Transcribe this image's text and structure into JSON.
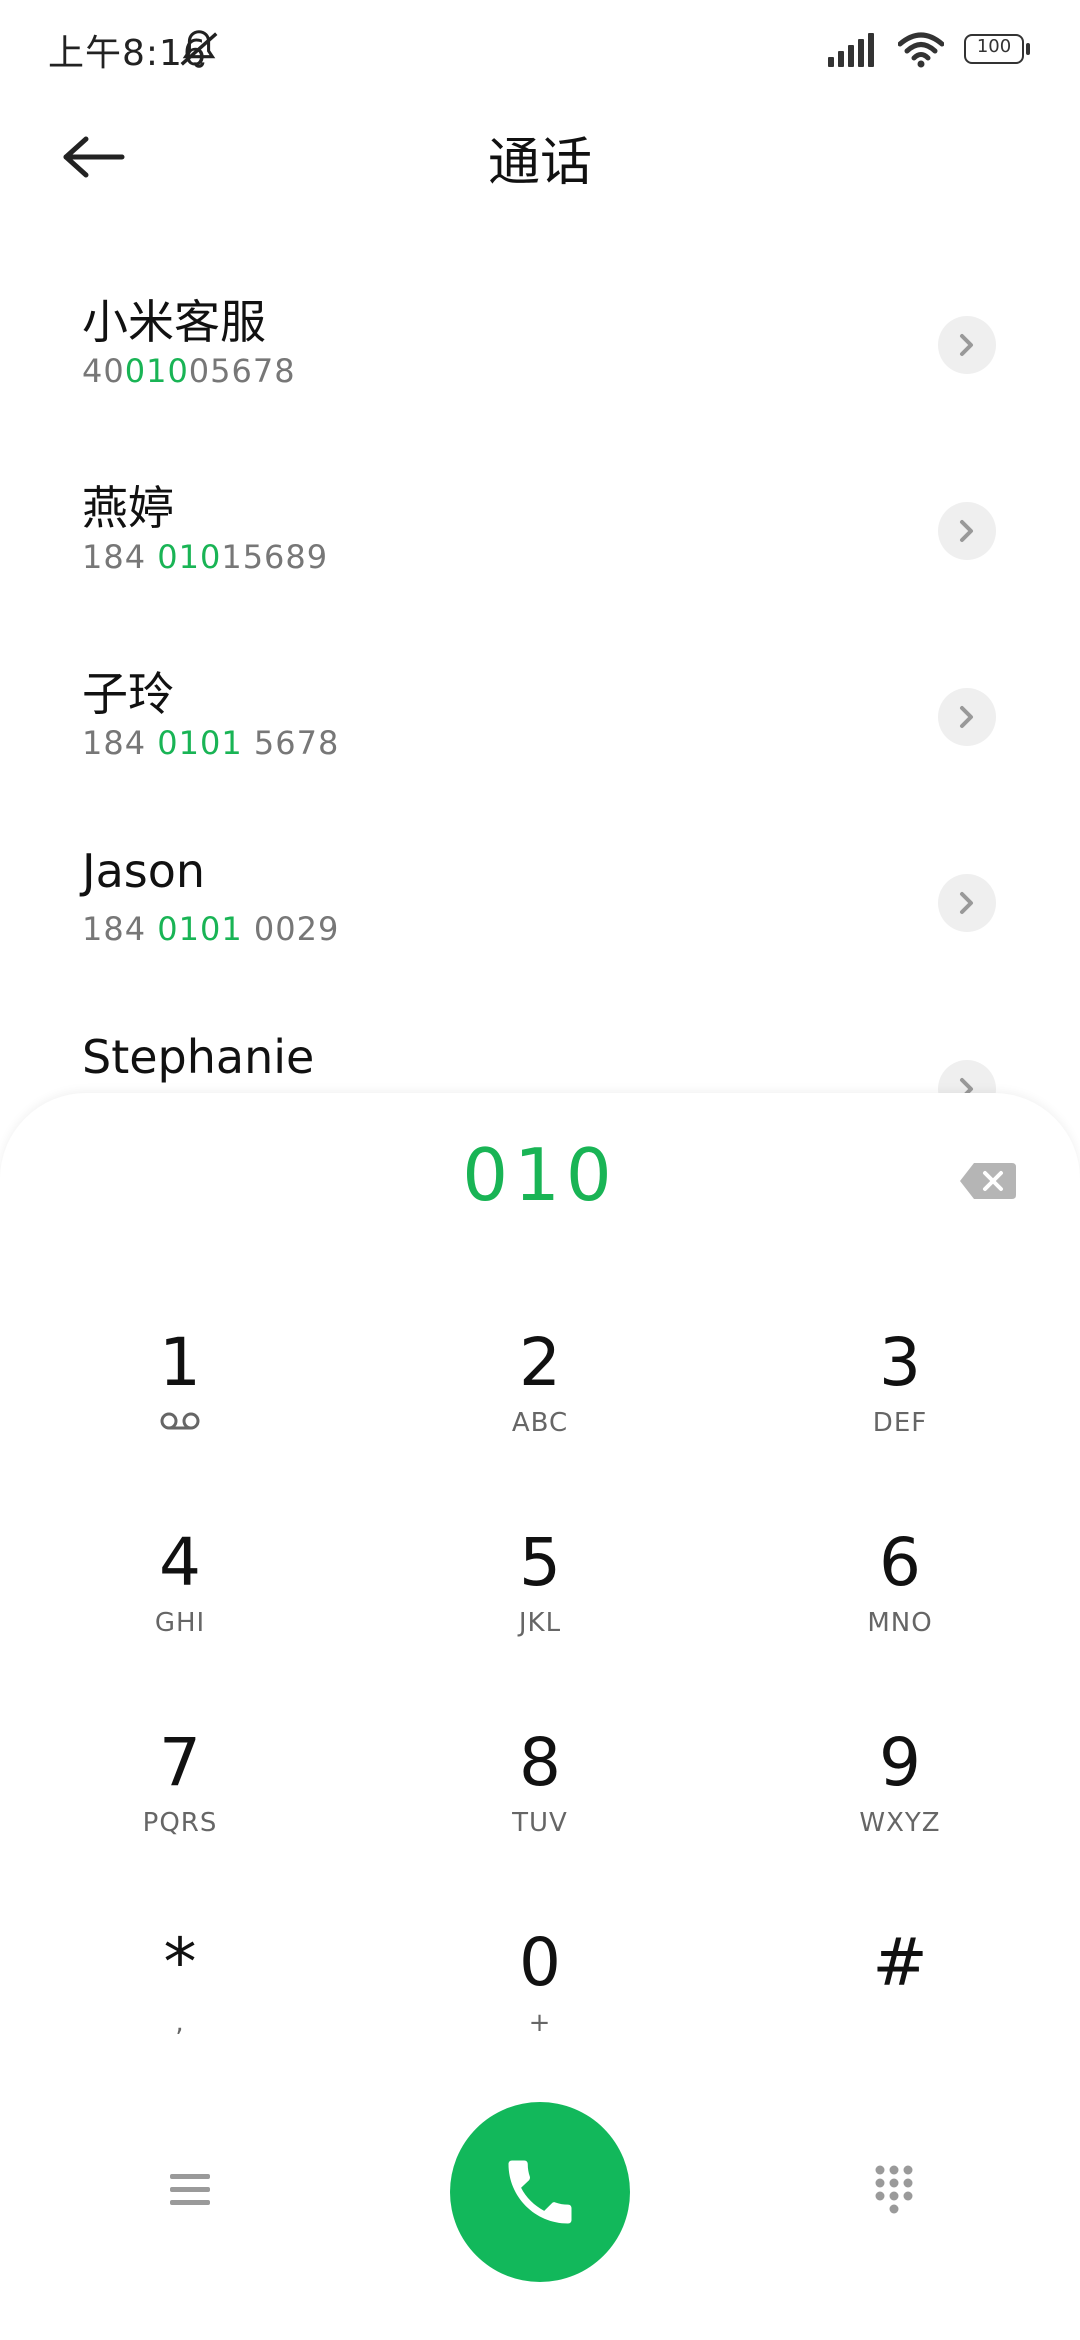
{
  "status_bar": {
    "time": "上午8:16",
    "battery": "100"
  },
  "header": {
    "title": "通话"
  },
  "contacts": [
    {
      "name": "小米客服",
      "number_prefix": "40",
      "number_match": "010",
      "number_suffix": "05678"
    },
    {
      "name": "燕婷",
      "number_prefix": "184 ",
      "number_match": "010",
      "number_suffix": "15689"
    },
    {
      "name": "子玲",
      "number_prefix": "184 ",
      "number_match": "0101",
      "number_suffix": " 5678"
    },
    {
      "name": "Jason",
      "number_prefix": "184 ",
      "number_match": "0101",
      "number_suffix": " 0029"
    },
    {
      "name": "Stephanie",
      "number_prefix": "",
      "number_match": "",
      "number_suffix": ""
    }
  ],
  "dialer": {
    "input": "010",
    "keys": [
      {
        "digit": "1",
        "letters": ""
      },
      {
        "digit": "2",
        "letters": "ABC"
      },
      {
        "digit": "3",
        "letters": "DEF"
      },
      {
        "digit": "4",
        "letters": "GHI"
      },
      {
        "digit": "5",
        "letters": "JKL"
      },
      {
        "digit": "6",
        "letters": "MNO"
      },
      {
        "digit": "7",
        "letters": "PQRS"
      },
      {
        "digit": "8",
        "letters": "TUV"
      },
      {
        "digit": "9",
        "letters": "WXYZ"
      },
      {
        "digit": "*",
        "letters": ","
      },
      {
        "digit": "0",
        "letters": "+"
      },
      {
        "digit": "#",
        "letters": ""
      }
    ]
  },
  "colors": {
    "accent": "#19b455",
    "call_button": "#12b85b"
  },
  "icons": {
    "back": "arrow-left-icon",
    "silent": "bell-slash-icon",
    "signal": "signal-icon",
    "wifi": "wifi-icon",
    "battery": "battery-icon",
    "chevron": "chevron-right-icon",
    "delete": "backspace-icon",
    "voicemail": "voicemail-icon",
    "menu": "menu-icon",
    "call": "phone-icon",
    "dialpad": "dialpad-icon"
  }
}
